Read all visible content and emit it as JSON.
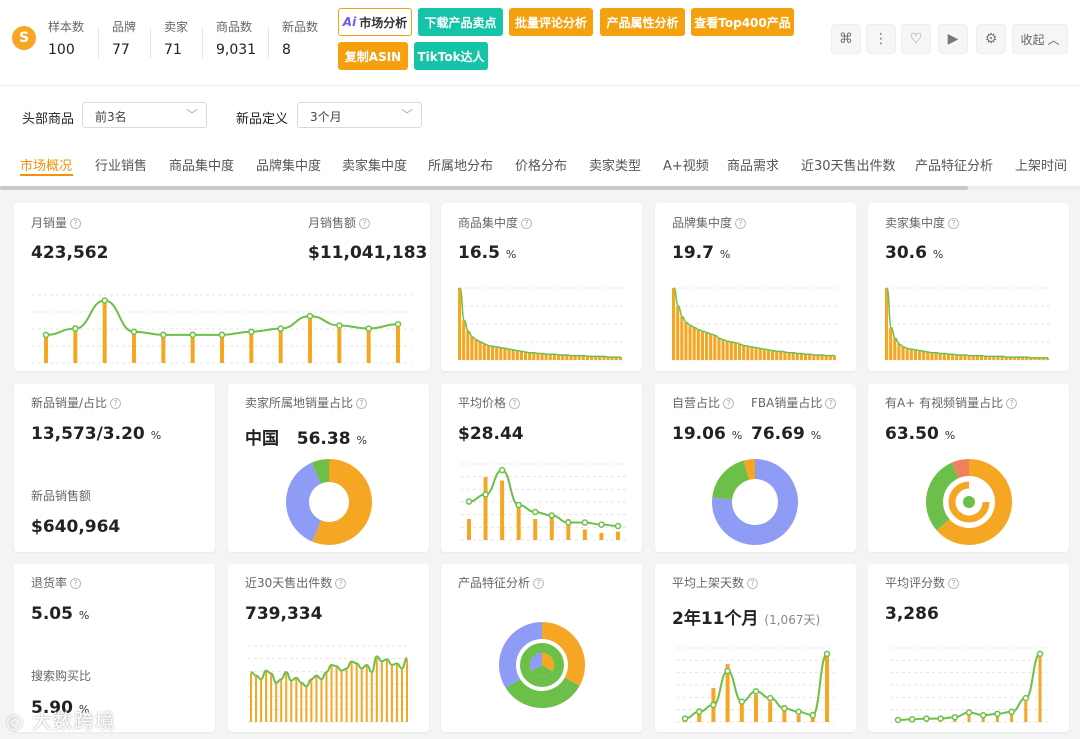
{
  "header": {
    "logo_letter": "S",
    "stats": [
      {
        "label": "样本数",
        "value": "100"
      },
      {
        "label": "品牌",
        "value": "77"
      },
      {
        "label": "卖家",
        "value": "71"
      },
      {
        "label": "商品数",
        "value": "9,031"
      },
      {
        "label": "新品数",
        "value": "8"
      }
    ],
    "buttons": {
      "ai_market": "市场分析",
      "ai_prefix": "Ai",
      "download_selling": "下载产品卖点",
      "batch_review": "批量评论分析",
      "product_attr": "产品属性分析",
      "top400": "查看Top400产品",
      "copy_asin": "复制ASIN",
      "tiktok": "TikTok达人"
    },
    "collapse_label": "收起"
  },
  "filters": {
    "head_products_label": "头部商品",
    "head_products_value": "前3名",
    "new_def_label": "新品定义",
    "new_def_value": "3个月"
  },
  "tabs": [
    "市场概况",
    "行业销售",
    "商品集中度",
    "品牌集中度",
    "卖家集中度",
    "所属地分布",
    "价格分布",
    "卖家类型",
    "A+视频",
    "商品需求",
    "近30天售出件数",
    "产品特征分析",
    "上架时间"
  ],
  "cards": {
    "monthly_sales": {
      "title": "月销量",
      "value": "423,562"
    },
    "monthly_revenue": {
      "title": "月销售额",
      "value": "$11,041,183"
    },
    "product_conc": {
      "title": "商品集中度",
      "value": "16.5",
      "unit": "%"
    },
    "brand_conc": {
      "title": "品牌集中度",
      "value": "19.7",
      "unit": "%"
    },
    "seller_conc": {
      "title": "卖家集中度",
      "value": "30.6",
      "unit": "%"
    },
    "new_sales": {
      "title": "新品销量/占比",
      "value": "13,573/3.20",
      "unit": "%",
      "rev_title": "新品销售额",
      "rev_value": "$640,964"
    },
    "seller_origin": {
      "title": "卖家所属地销量占比",
      "region": "中国",
      "value": "56.38",
      "unit": "%"
    },
    "avg_price": {
      "title": "平均价格",
      "value": "$28.44"
    },
    "self_fba": {
      "title1": "自营占比",
      "title2": "FBA销量占比",
      "value1": "19.06",
      "value2": "76.69",
      "unit": "%"
    },
    "aplus": {
      "title": "有A+ 有视频销量占比",
      "value": "63.50",
      "unit": "%"
    },
    "return_rate": {
      "title": "退货率",
      "value": "5.05",
      "unit": "%",
      "search_title": "搜索购买比",
      "search_value": "5.90",
      "search_unit": "%"
    },
    "sold30": {
      "title": "近30天售出件数",
      "value": "739,334"
    },
    "features": {
      "title": "产品特征分析"
    },
    "avg_listing": {
      "title": "平均上架天数",
      "value": "2年11个月",
      "sub": "(1,067天)"
    },
    "avg_rating": {
      "title": "平均评分数",
      "value": "3,286"
    }
  },
  "colors": {
    "orange": "#f5a623",
    "green": "#6cc04a",
    "purple": "#8f9cf5",
    "teal": "#15c3a8",
    "salmon": "#f07f5e"
  },
  "charts": {
    "monthly": {
      "bars": [
        0.45,
        0.6,
        1,
        0.5,
        0.5,
        0.5,
        0.5,
        0.5,
        0.55,
        0.75,
        0.6,
        0.55,
        0.65
      ],
      "line": [
        0.45,
        0.55,
        1,
        0.5,
        0.45,
        0.45,
        0.45,
        0.5,
        0.55,
        0.75,
        0.6,
        0.55,
        0.62
      ]
    },
    "product_conc": [
      1,
      0.55,
      0.4,
      0.32,
      0.28,
      0.25,
      0.22,
      0.2,
      0.19,
      0.18,
      0.17,
      0.16,
      0.15,
      0.14,
      0.13,
      0.12,
      0.11,
      0.1,
      0.1,
      0.09,
      0.09,
      0.08,
      0.08,
      0.08,
      0.07,
      0.07,
      0.07,
      0.06,
      0.06,
      0.06,
      0.06,
      0.05,
      0.05,
      0.05,
      0.05,
      0.05,
      0.04,
      0.04,
      0.04,
      0.04
    ],
    "brand_conc": [
      1,
      0.75,
      0.6,
      0.52,
      0.48,
      0.45,
      0.42,
      0.4,
      0.38,
      0.36,
      0.34,
      0.3,
      0.28,
      0.26,
      0.25,
      0.24,
      0.22,
      0.2,
      0.19,
      0.18,
      0.17,
      0.16,
      0.15,
      0.14,
      0.13,
      0.12,
      0.12,
      0.11,
      0.1,
      0.1,
      0.09,
      0.09,
      0.08,
      0.08,
      0.07,
      0.07,
      0.07,
      0.06,
      0.06,
      0.06
    ],
    "seller_conc": [
      1,
      0.45,
      0.3,
      0.22,
      0.18,
      0.16,
      0.15,
      0.14,
      0.13,
      0.12,
      0.11,
      0.1,
      0.1,
      0.09,
      0.09,
      0.08,
      0.08,
      0.07,
      0.07,
      0.07,
      0.06,
      0.06,
      0.06,
      0.06,
      0.05,
      0.05,
      0.05,
      0.05,
      0.05,
      0.04,
      0.04,
      0.04,
      0.04,
      0.04,
      0.04,
      0.03,
      0.03,
      0.03,
      0.03,
      0.03
    ],
    "seller_origin_pie": [
      56.38,
      37,
      6.62
    ],
    "avg_price": {
      "bars": [
        0.3,
        0.9,
        0.85,
        0.5,
        0.3,
        0.35,
        0.3,
        0.15,
        0.1,
        0.12
      ],
      "line": [
        0.55,
        0.65,
        1,
        0.5,
        0.4,
        0.35,
        0.25,
        0.25,
        0.22,
        0.2
      ]
    },
    "fba_pie": [
      76.69,
      19.06,
      4.25
    ],
    "aplus_pie": [
      63.5,
      30,
      6.5
    ],
    "sold30": [
      0.7,
      0.65,
      0.6,
      0.72,
      0.68,
      0.55,
      0.6,
      0.7,
      0.58,
      0.62,
      0.55,
      0.5,
      0.6,
      0.65,
      0.6,
      0.7,
      0.8,
      0.78,
      0.72,
      0.75,
      0.85,
      0.82,
      0.75,
      0.8,
      0.7,
      0.92,
      0.85,
      0.88,
      0.8,
      0.82,
      0.75,
      0.9
    ],
    "features_pie": [
      33,
      33,
      34
    ],
    "listing": {
      "bars": [
        0.05,
        0.2,
        0.5,
        0.85,
        0.3,
        0.4,
        0.3,
        0.25,
        0.1,
        0.15,
        1
      ],
      "line": [
        0.05,
        0.15,
        0.25,
        0.75,
        0.3,
        0.45,
        0.35,
        0.2,
        0.15,
        0.1,
        1
      ]
    },
    "rating": {
      "bars": [
        0.02,
        0.02,
        0.03,
        0.03,
        0.05,
        0.1,
        0.08,
        0.1,
        0.12,
        0.3,
        1
      ],
      "line": [
        0.03,
        0.04,
        0.05,
        0.05,
        0.07,
        0.14,
        0.1,
        0.12,
        0.15,
        0.35,
        1
      ]
    }
  },
  "watermark": "大数跨境"
}
